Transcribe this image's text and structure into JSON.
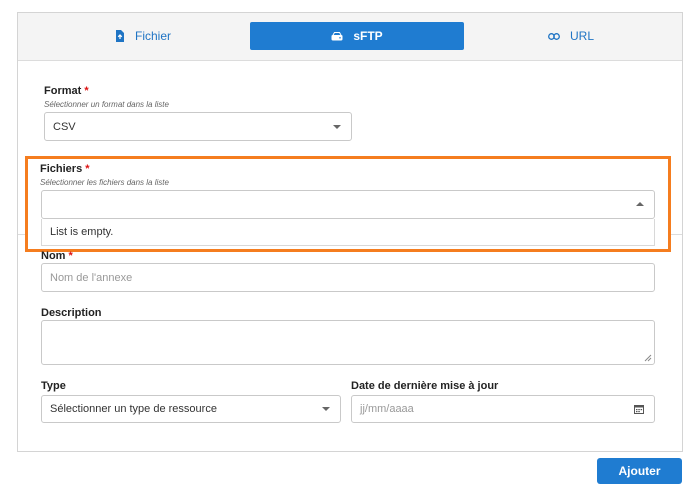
{
  "tabs": [
    {
      "label": "Fichier",
      "icon": "file-upload-icon"
    },
    {
      "label": "sFTP",
      "icon": "server-icon"
    },
    {
      "label": "URL",
      "icon": "link-icon"
    }
  ],
  "format": {
    "label": "Format",
    "required": "*",
    "hint": "Sélectionner un format dans la liste",
    "value": "CSV"
  },
  "fichiers": {
    "label": "Fichiers",
    "required": "*",
    "hint": "Sélectionner les fichiers dans la liste",
    "value": "",
    "empty_message": "List is empty."
  },
  "nom": {
    "label": "Nom",
    "required": "*",
    "placeholder": "Nom de l'annexe"
  },
  "description": {
    "label": "Description",
    "value": ""
  },
  "type": {
    "label": "Type",
    "placeholder": "Sélectionner un type de ressource"
  },
  "date": {
    "label": "Date de dernière mise à jour",
    "placeholder": "jj/mm/aaaa"
  },
  "submit_label": "Ajouter",
  "colors": {
    "accent": "#1f7cd1",
    "highlight": "#f57d1f",
    "required": "#d11111"
  }
}
